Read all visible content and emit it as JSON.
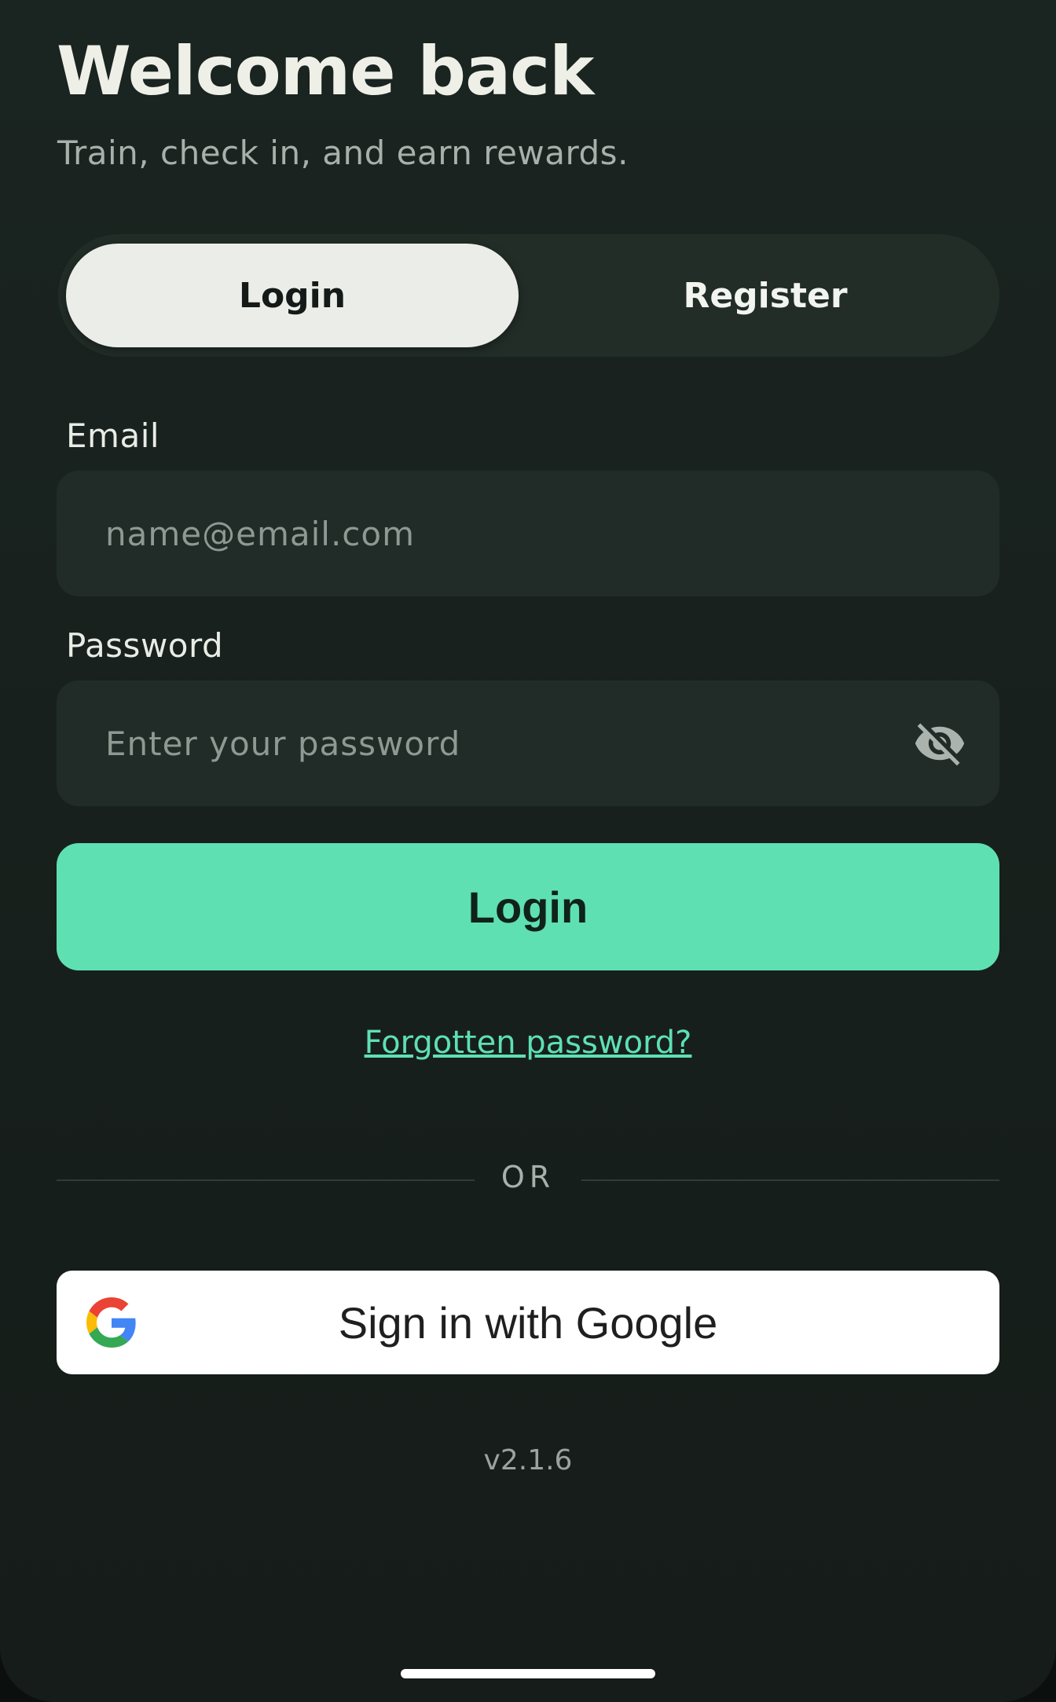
{
  "header": {
    "title": "Welcome back",
    "subtitle": "Train, check in, and earn rewards."
  },
  "auth_tabs": {
    "login": "Login",
    "register": "Register",
    "selected": "Login"
  },
  "email": {
    "label": "Email",
    "placeholder": "name@email.com",
    "value": ""
  },
  "password": {
    "label": "Password",
    "placeholder": "Enter your password",
    "value": "",
    "visibility_icon": "eye-off-icon"
  },
  "login_button": {
    "label": "Login"
  },
  "forgot_link": "Forgotten password?",
  "separator": "OR",
  "google_button": {
    "label": "Sign in with Google",
    "icon": "google-logo-icon"
  },
  "version": "v2.1.6",
  "colors": {
    "background": "#1a2420",
    "accent": "#5ee0b3",
    "input_background": "#212b27",
    "tab_active_background": "#ebeee8",
    "text_muted": "#a7b1ab"
  }
}
